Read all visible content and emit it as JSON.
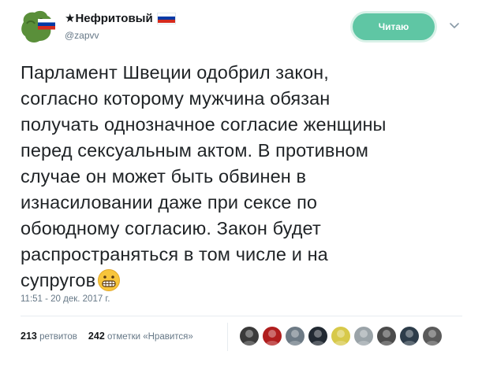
{
  "user": {
    "display_name": "★Нефритовый",
    "handle": "@zapvv",
    "flag_colors": [
      "#ffffff",
      "#0039a6",
      "#d52b1e"
    ]
  },
  "follow_button": {
    "label": "Читаю"
  },
  "menu": {
    "icon": "chevron-down-icon"
  },
  "tweet": {
    "lines": [
      "Парламент Швеции одобрил закон,",
      "согласно которому мужчина обязан",
      "получать однозначное согласие женщины",
      "перед сексуальным актом. В противном",
      "случае он может быть обвинен в",
      "изнасиловании даже при сексе по",
      "обоюдному согласию.  Закон будет",
      "распространяться в том числе и на",
      "супругов"
    ],
    "emoji": "grimacing-face-emoji",
    "timestamp": "11:51 - 20 дек. 2017 г."
  },
  "stats": {
    "retweets_count": "213",
    "retweets_label": "ретвитов",
    "likes_count": "242",
    "likes_label": "отметки «Нравится»"
  },
  "likers": [
    {
      "name": "liker-avatar-1",
      "color": "#3a3a3a"
    },
    {
      "name": "liker-avatar-2",
      "color": "#b01e1e"
    },
    {
      "name": "liker-avatar-3",
      "color": "#6d7a85"
    },
    {
      "name": "liker-avatar-4",
      "color": "#222a33"
    },
    {
      "name": "liker-avatar-5",
      "color": "#d7c94a"
    },
    {
      "name": "liker-avatar-6",
      "color": "#9aa3a8"
    },
    {
      "name": "liker-avatar-7",
      "color": "#4b4b4b"
    },
    {
      "name": "liker-avatar-8",
      "color": "#2d3c4a"
    },
    {
      "name": "liker-avatar-9",
      "color": "#5a5a5a"
    }
  ],
  "colors": {
    "accent": "#5fc6a4",
    "secondary_text": "#657786",
    "avatar_green": "#5a8f3a"
  }
}
